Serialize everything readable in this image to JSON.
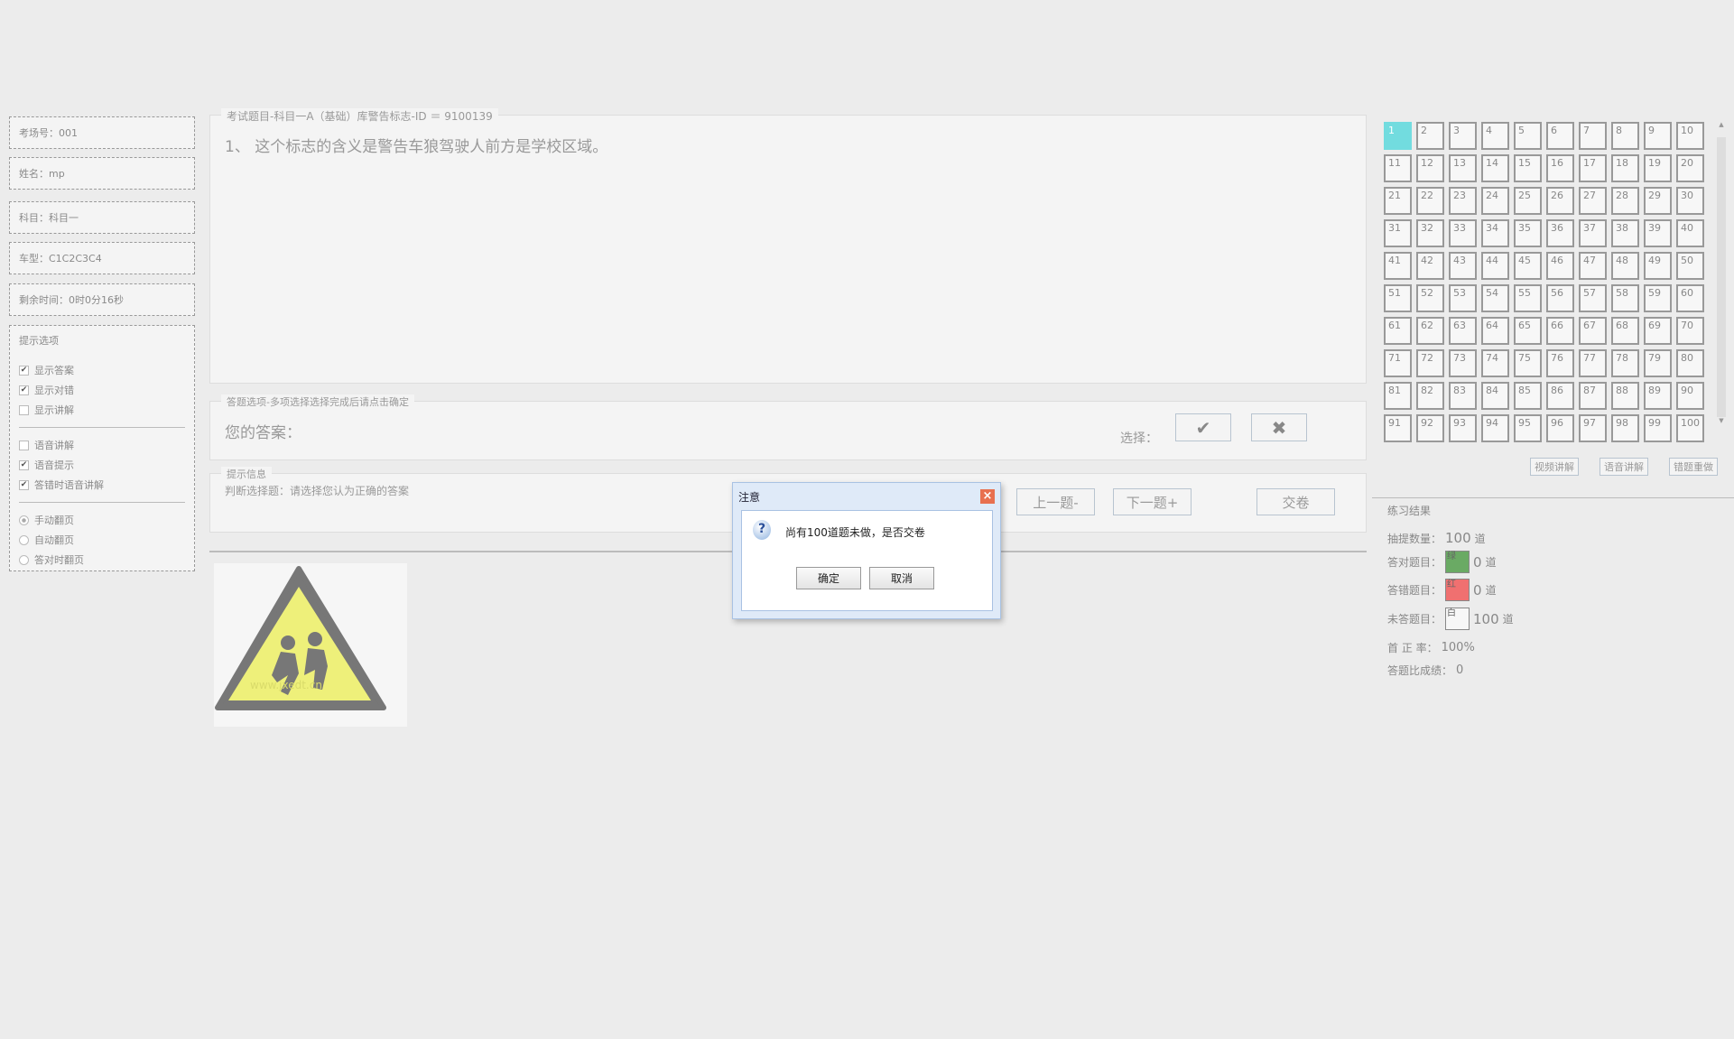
{
  "left": {
    "exam_room": "考场号：001",
    "name": "姓名：mp",
    "subject": "科目：科目一",
    "car_type": "车型：C1C2C3C4",
    "time_left": "剩余时间：0时0分16秒",
    "hints_title": "提示选项",
    "group1": [
      {
        "label": "显示答案",
        "checked": true
      },
      {
        "label": "显示对错",
        "checked": true
      },
      {
        "label": "显示讲解",
        "checked": false
      }
    ],
    "group2": [
      {
        "label": "语音讲解",
        "checked": false
      },
      {
        "label": "语音提示",
        "checked": true
      },
      {
        "label": "答错时语音讲解",
        "checked": true
      }
    ],
    "group3": [
      {
        "label": "手动翻页",
        "checked": true
      },
      {
        "label": "自动翻页",
        "checked": false
      },
      {
        "label": "答对时翻页",
        "checked": false
      }
    ]
  },
  "question": {
    "legend": "考试题目-科目一A（基础）库警告标志-ID ＝ 9100139",
    "text": "1、 这个标志的含义是警告车狼驾驶人前方是学校区域。"
  },
  "answer": {
    "legend": "答题选项-多项选择选择完成后请点击确定",
    "your_answer": "您的答案：",
    "choose": "选择：",
    "right_icon": "✔",
    "wrong_icon": "✖"
  },
  "hint": {
    "legend": "提示信息",
    "text": "判断选择题：请选择您认为正确的答案",
    "prev": "上一题-",
    "next": "下一题+",
    "submit": "交卷"
  },
  "image": {
    "watermark": "www.jxedt.cn"
  },
  "dialog": {
    "title": "注意",
    "message": "尚有100道题未做，是否交卷",
    "ok": "确定",
    "cancel": "取消",
    "close_icon": "×"
  },
  "grid": {
    "current": 1,
    "count": 100
  },
  "side_buttons": {
    "video": "视频讲解",
    "voice": "语音讲解",
    "redo": "错题重做"
  },
  "results": {
    "title": "练习结果",
    "draw_label": "抽提数量：",
    "draw_value": "100",
    "unit": "道",
    "right_label": "答对题目：",
    "right_swatch": "绿",
    "right_value": "0",
    "wrong_label": "答错题目：",
    "wrong_swatch": "红",
    "wrong_value": "0",
    "undone_label": "未答题目：",
    "undone_swatch": "白",
    "undone_value": "100",
    "rate_label": "首 正 率：",
    "rate_value": "100%",
    "score_label": "答题比成绩：",
    "score_value": "0",
    "colors": {
      "right": "#6aaa64",
      "wrong": "#f07070",
      "undone": "#f7f7f7"
    }
  }
}
